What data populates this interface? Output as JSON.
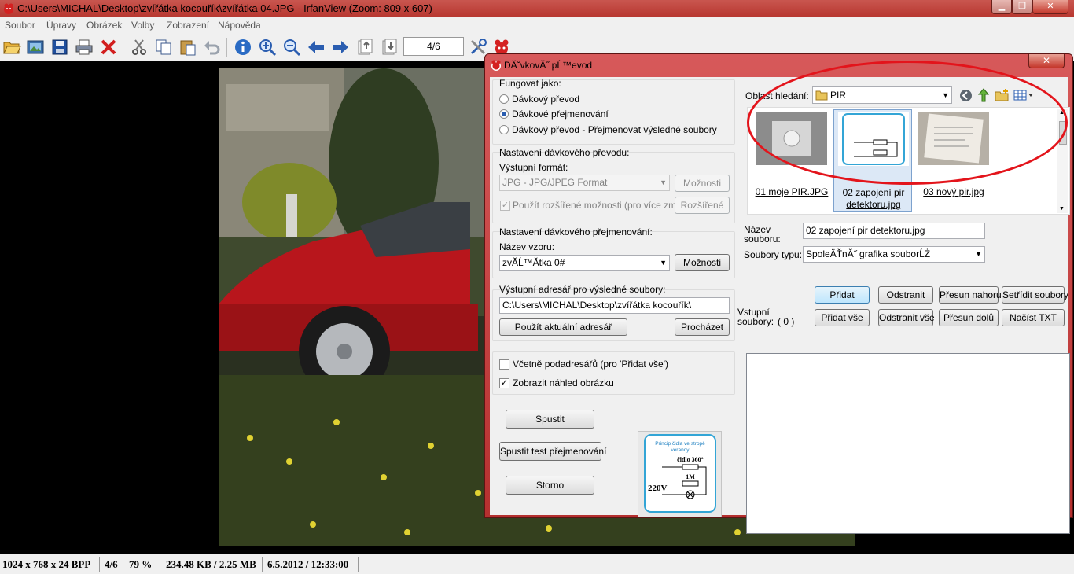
{
  "window": {
    "title": "C:\\Users\\MICHAL\\Desktop\\zvířátka kocouřík\\zvířátka 04.JPG - IrfanView (Zoom: 809 x 607)",
    "minimize": "▁",
    "maximize": "❐",
    "close": "✕"
  },
  "menu": [
    "Soubor",
    "Úpravy",
    "Obrázek",
    "Volby",
    "Zobrazení",
    "Nápověda"
  ],
  "toolbar": {
    "page_indicator": "4/6"
  },
  "statusbar": {
    "dimensions": "1024 x 768 x 24 BPP",
    "page": "4/6",
    "zoom": "79 %",
    "size": "234.48 KB / 2.25 MB",
    "datetime": "6.5.2012 / 12:33:00"
  },
  "dialog": {
    "title": "DĂˇvkovĂ˝ pĹ™evod",
    "close": "✕",
    "mode_group": {
      "label": "Fungovat jako:",
      "options": [
        "Dávkový převod",
        "Dávkové přejmenování",
        "Dávkový převod - Přejmenovat výsledné soubory"
      ],
      "selected_index": 1
    },
    "convert_group": {
      "label": "Nastavení dávkového převodu:",
      "format_label": "Výstupní formát:",
      "format_value": "JPG - JPG/JPEG Format",
      "options_button": "Možnosti",
      "advanced_checkbox": "Použít rozšířené možnosti (pro více změn)",
      "advanced_button": "Rozšířené"
    },
    "rename_group": {
      "label": "Nastavení dávkového přejmenování:",
      "pattern_label": "Název vzoru:",
      "pattern_value": "zvĂ­Ĺ™Ătka 0#",
      "options_button": "Možnosti"
    },
    "output_group": {
      "label": "Výstupní adresář pro výsledné soubory:",
      "path": "C:\\Users\\MICHAL\\Desktop\\zvířátka kocouřík\\",
      "use_current_button": "Použít aktuální adresář",
      "browse_button": "Procházet"
    },
    "checkboxes": {
      "subfolders": "Včetně podadresářů (pro 'Přidat vše')",
      "subfolders_checked": false,
      "preview": "Zobrazit náhled obrázku",
      "preview_checked": true
    },
    "actions": {
      "start": "Spustit",
      "test_rename": "Spustit test přejmenování",
      "cancel": "Storno"
    },
    "browser": {
      "look_in_label": "Oblast hledání:",
      "folder": "PIR",
      "files": [
        {
          "name": "01 moje PIR.JPG",
          "selected": false
        },
        {
          "name": "02 zapojení pir detektoru.jpg",
          "selected": true
        },
        {
          "name": "03 nový pir.jpg",
          "selected": false
        }
      ],
      "filename_label": "Název souboru:",
      "filename_value": "02 zapojení pir detektoru.jpg",
      "filetype_label": "Soubory typu:",
      "filetype_value": "SpoleÄŤnĂ˝ grafika souborĹŻ"
    },
    "list_buttons": {
      "add": "Přidat",
      "remove": "Odstranit",
      "move_up": "Přesun nahoru",
      "sort": "Setřídit soubory",
      "add_all": "Přidat vše",
      "remove_all": "Odstranit vše",
      "move_down": "Přesun dolů",
      "load_txt": "Načíst TXT"
    },
    "input_files": {
      "label": "Vstupní soubory:",
      "count": "( 0 )"
    },
    "preview_image": {
      "title_line1": "Princip čidla ve stropě",
      "title_line2": "verandy",
      "sensor": "čidlo 360°",
      "resistor": "1M",
      "voltage": "220V"
    }
  }
}
